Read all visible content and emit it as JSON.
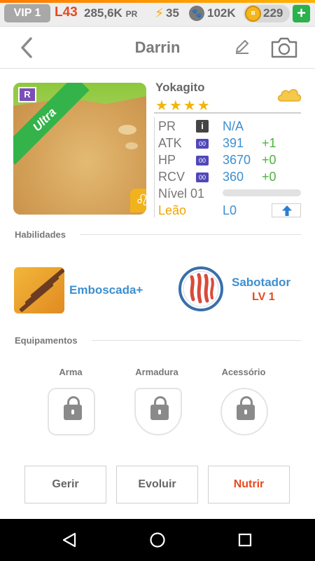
{
  "topbar": {
    "vip": "VIP 1",
    "level": "L43",
    "pr_value": "285,6K",
    "pr_suffix": "PR",
    "energy": "35",
    "paw_count": "102K",
    "coins": "229",
    "bolt_icon": "lightning-icon",
    "paw_icon": "paw-icon",
    "coin_icon": "coin-icon",
    "plus_icon": "plus-icon"
  },
  "header": {
    "title": "Darrin",
    "back_icon": "back-chevron-icon",
    "edit_icon": "edit-icon",
    "camera_icon": "camera-icon"
  },
  "card": {
    "rarity_label": "Ultra",
    "r_badge": "R",
    "zodiac_glyph": "♌",
    "accent_color": "#33b34a"
  },
  "monster": {
    "species": "Yokagito",
    "stars": "★★★★",
    "cloud_icon": "cloud-icon",
    "stats": [
      {
        "label": "PR",
        "badge": "i",
        "value": "N/A",
        "bonus": ""
      },
      {
        "label": "ATK",
        "badge": "00",
        "value": "391",
        "bonus": "+1"
      },
      {
        "label": "HP",
        "badge": "00",
        "value": "3670",
        "bonus": "+0"
      },
      {
        "label": "RCV",
        "badge": "00",
        "value": "360",
        "bonus": "+0"
      }
    ],
    "level_label": "Nível 01",
    "xp_fraction": 0,
    "zodiac_name": "Leão",
    "rank": "L0",
    "upgrade_icon": "arrow-up-icon"
  },
  "sections": {
    "skills": "Habilidades",
    "equipment": "Equipamentos"
  },
  "skills": [
    {
      "name": "Emboscada+",
      "icon": "arrows-skill-icon"
    },
    {
      "name": "Sabotador",
      "level": "LV 1",
      "icon": "claw-skill-icon"
    }
  ],
  "equipment": [
    {
      "label": "Arma",
      "icon": "lock-icon"
    },
    {
      "label": "Armadura",
      "icon": "lock-icon"
    },
    {
      "label": "Acessório",
      "icon": "lock-icon"
    }
  ],
  "buttons": {
    "manage": "Gerir",
    "evolve": "Evoluir",
    "feed": "Nutrir"
  },
  "navbar": {
    "back": "nav-back-icon",
    "home": "nav-home-icon",
    "recents": "nav-recents-icon"
  }
}
